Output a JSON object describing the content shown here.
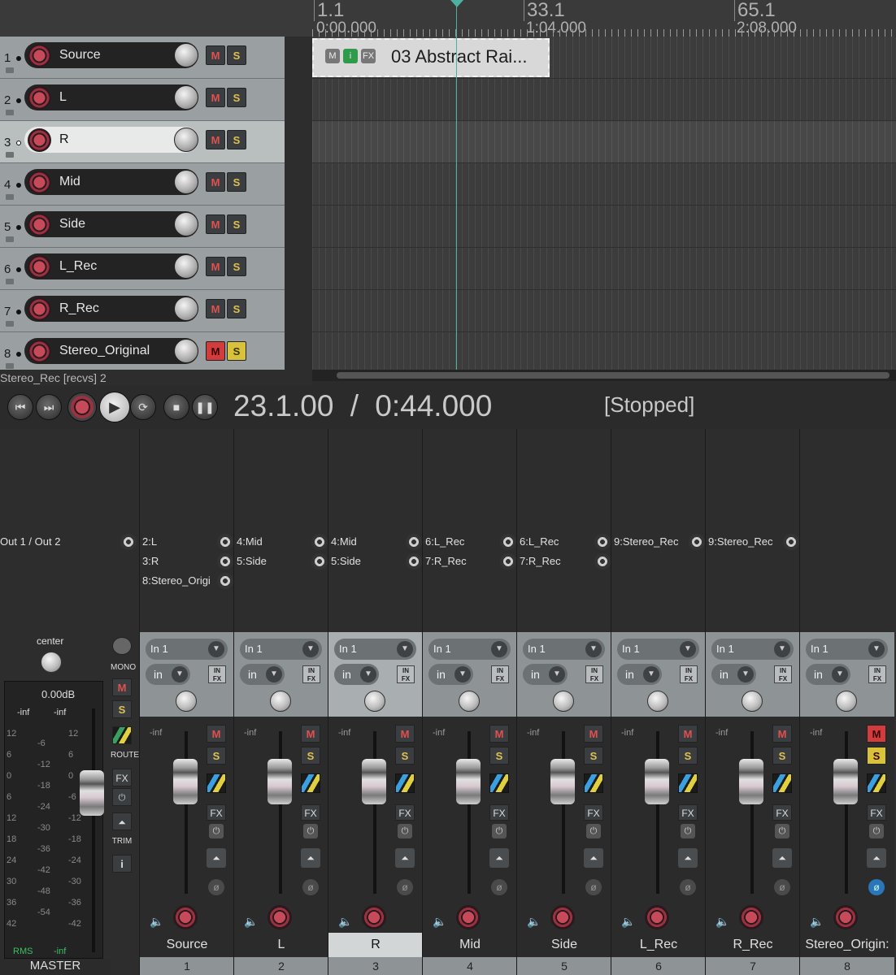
{
  "ruler": {
    "marks": [
      {
        "bar": "1.1",
        "time": "0:00.000"
      },
      {
        "bar": "33.1",
        "time": "1:04.000"
      },
      {
        "bar": "65.1",
        "time": "2:08.000"
      }
    ]
  },
  "tracks": [
    {
      "num": "1",
      "name": "Source",
      "m": "M",
      "s": "S"
    },
    {
      "num": "2",
      "name": "L",
      "m": "M",
      "s": "S"
    },
    {
      "num": "3",
      "name": "R",
      "m": "M",
      "s": "S"
    },
    {
      "num": "4",
      "name": "Mid",
      "m": "M",
      "s": "S"
    },
    {
      "num": "5",
      "name": "Side",
      "m": "M",
      "s": "S"
    },
    {
      "num": "6",
      "name": "L_Rec",
      "m": "M",
      "s": "S"
    },
    {
      "num": "7",
      "name": "R_Rec",
      "m": "M",
      "s": "S"
    },
    {
      "num": "8",
      "name": "Stereo_Original",
      "m": "M",
      "s": "S"
    }
  ],
  "item": {
    "name": "03 Abstract Rai...",
    "icons": [
      "M",
      "i",
      "FX"
    ]
  },
  "status": {
    "recvs": "Stereo_Rec [recvs] 2"
  },
  "transport": {
    "position": "23.1.00",
    "separator": "/",
    "time": "0:44.000",
    "state": "[Stopped]"
  },
  "master": {
    "pan_label": "center",
    "volume": "0.00dB",
    "peak_l": "-inf",
    "peak_r": "-inf",
    "scale_left": [
      "12",
      "6",
      "0",
      "6",
      "12",
      "18",
      "24",
      "30",
      "36",
      "42"
    ],
    "scale_mid": [
      "-6",
      "-12",
      "-18",
      "-24",
      "-30",
      "-36",
      "-42",
      "-48",
      "-54"
    ],
    "scale_right": [
      "12",
      "6",
      "0",
      "-6",
      "-12",
      "-18",
      "-24",
      "-30",
      "-36",
      "-42"
    ],
    "rms_label": "RMS",
    "rms_value": "-inf",
    "output": "Out 1 / Out 2",
    "mono": "MONO",
    "m": "M",
    "s": "S",
    "route": "ROUTE",
    "fx": "FX",
    "trim": "TRIM",
    "info": "i",
    "label": "MASTER"
  },
  "strips": [
    {
      "name": "Source",
      "num": "1",
      "sends": [
        "2:L",
        "3:R",
        "8:Stereo_Origi"
      ],
      "input": "In 1",
      "in": "in",
      "inf": "-inf",
      "m": "M",
      "s": "S",
      "fx": "FX"
    },
    {
      "name": "L",
      "num": "2",
      "sends": [
        "4:Mid",
        "5:Side"
      ],
      "input": "In 1",
      "in": "in",
      "inf": "-inf",
      "m": "M",
      "s": "S",
      "fx": "FX"
    },
    {
      "name": "R",
      "num": "3",
      "sends": [
        "4:Mid",
        "5:Side"
      ],
      "input": "In 1",
      "in": "in",
      "inf": "-inf",
      "m": "M",
      "s": "S",
      "fx": "FX"
    },
    {
      "name": "Mid",
      "num": "4",
      "sends": [
        "6:L_Rec",
        "7:R_Rec"
      ],
      "input": "In 1",
      "in": "in",
      "inf": "-inf",
      "m": "M",
      "s": "S",
      "fx": "FX"
    },
    {
      "name": "Side",
      "num": "5",
      "sends": [
        "6:L_Rec",
        "7:R_Rec"
      ],
      "input": "In 1",
      "in": "in",
      "inf": "-inf",
      "m": "M",
      "s": "S",
      "fx": "FX"
    },
    {
      "name": "L_Rec",
      "num": "6",
      "sends": [
        "9:Stereo_Rec"
      ],
      "input": "In 1",
      "in": "in",
      "inf": "-inf",
      "m": "M",
      "s": "S",
      "fx": "FX"
    },
    {
      "name": "R_Rec",
      "num": "7",
      "sends": [
        "9:Stereo_Rec"
      ],
      "input": "In 1",
      "in": "in",
      "inf": "-inf",
      "m": "M",
      "s": "S",
      "fx": "FX"
    },
    {
      "name": "Stereo_Origin:",
      "num": "8",
      "sends": [],
      "input": "In 1",
      "in": "in",
      "inf": "-inf",
      "m": "M",
      "s": "S",
      "fx": "FX"
    }
  ],
  "colors": {
    "accent_cursor": "#4db0a0",
    "mute_on": "#d23c3c",
    "solo_on": "#d8c23a"
  }
}
